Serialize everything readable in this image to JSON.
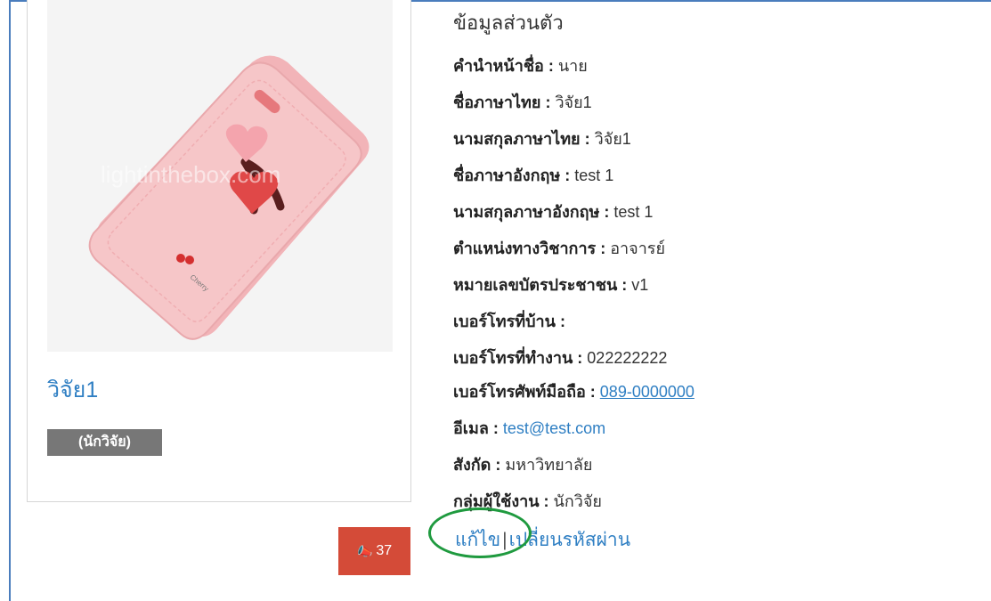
{
  "profile": {
    "name": "วิจัย1",
    "role_badge": "(นักวิจัย)",
    "photo_watermark": "lightinthebox.com",
    "notify_count": "37",
    "notify_icon": "bullhorn-icon"
  },
  "info": {
    "section_title": "ข้อมูลส่วนตัว",
    "fields": [
      {
        "label": "คำนำหน้าชื่อ : ",
        "value": "นาย"
      },
      {
        "label": "ชื่อภาษาไทย : ",
        "value": "วิจัย1"
      },
      {
        "label": "นามสกุลภาษาไทย : ",
        "value": "วิจัย1"
      },
      {
        "label": "ชื่อภาษาอังกฤษ : ",
        "value": "test 1"
      },
      {
        "label": "นามสกุลภาษาอังกฤษ : ",
        "value": "test 1"
      },
      {
        "label": "ตำแหน่งทางวิชาการ : ",
        "value": "อาจารย์"
      },
      {
        "label": "หมายเลขบัตรประชาชน : ",
        "value": "v1"
      },
      {
        "label": "เบอร์โทรที่บ้าน : ",
        "value": ""
      },
      {
        "label": "เบอร์โทรที่ทำงาน : ",
        "value": "022222222"
      },
      {
        "label": "เบอร์โทรศัพท์มือถือ : ",
        "value": "089-0000000"
      },
      {
        "label": "อีเมล : ",
        "value": "test@test.com"
      },
      {
        "label": "สังกัด : ",
        "value": "มหาวิทยาลัย"
      },
      {
        "label": "กลุ่มผู้ใช้งาน : ",
        "value": "นักวิจัย"
      }
    ]
  },
  "actions": {
    "edit_label": "แก้ไข",
    "separator": "|",
    "change_password_label": "เปลี่ยนรหัสผ่าน"
  },
  "colors": {
    "link": "#2f7fc3",
    "badge": "#777777",
    "notify": "#d44b38",
    "highlight": "#1f9a3f",
    "frame": "#4a7dbd"
  }
}
